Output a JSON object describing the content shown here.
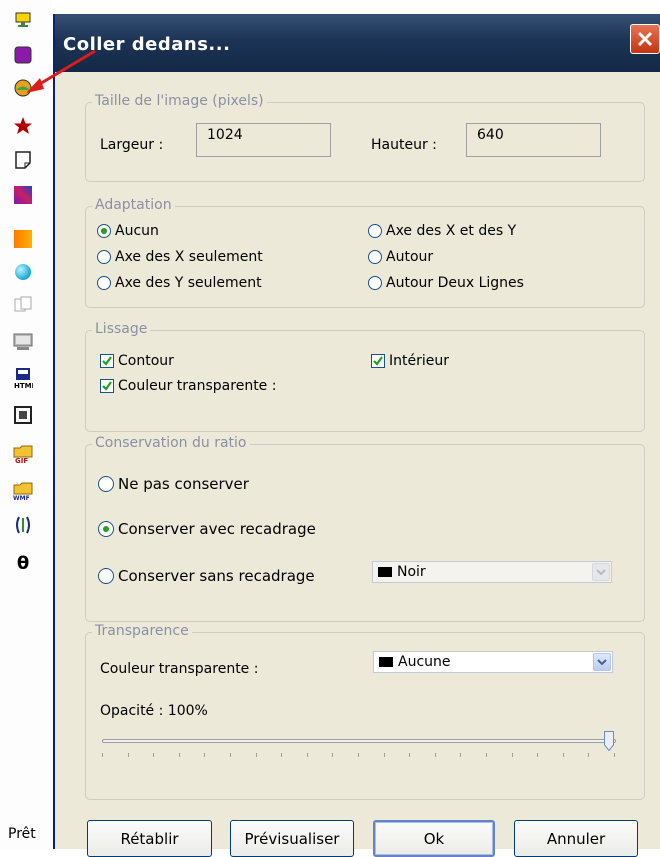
{
  "status": {
    "text": "Prêt"
  },
  "dialog": {
    "title": "Coller dedans...",
    "image_size": {
      "legend": "Taille de l'image (pixels)",
      "width_label": "Largeur :",
      "width_value": "1024",
      "height_label": "Hauteur :",
      "height_value": "640"
    },
    "adaptation": {
      "legend": "Adaptation",
      "options": [
        {
          "label": "Aucun",
          "selected": true
        },
        {
          "label": "Axe des X et des Y",
          "selected": false
        },
        {
          "label": "Axe des X seulement",
          "selected": false
        },
        {
          "label": "Autour",
          "selected": false
        },
        {
          "label": "Axe des Y seulement",
          "selected": false
        },
        {
          "label": "Autour Deux Lignes",
          "selected": false
        }
      ]
    },
    "smoothing": {
      "legend": "Lissage",
      "contour": {
        "label": "Contour",
        "checked": true
      },
      "interior": {
        "label": "Intérieur",
        "checked": true
      },
      "transparent_color": {
        "label": "Couleur transparente :",
        "checked": true
      }
    },
    "ratio": {
      "legend": "Conservation du ratio",
      "options": [
        {
          "label": "Ne pas conserver",
          "selected": false
        },
        {
          "label": "Conserver avec recadrage",
          "selected": true
        },
        {
          "label": "Conserver sans recadrage",
          "selected": false
        }
      ],
      "color_select": {
        "value": "Noir",
        "enabled": false
      }
    },
    "transparency": {
      "legend": "Transparence",
      "color_label": "Couleur transparente :",
      "color_select": {
        "value": "Aucune",
        "enabled": true
      },
      "opacity_label": "Opacité : 100%",
      "opacity_value": 100
    },
    "buttons": {
      "reset": "Rétablir",
      "preview": "Prévisualiser",
      "ok": "Ok",
      "cancel": "Annuler"
    }
  },
  "colors": {
    "title_bar": "#1c3456",
    "dialog_bg": "#ece9d8",
    "accent_arrow": "#e01b1b",
    "radio_dot": "#21a121",
    "check_mark": "#21a121"
  },
  "toolbar_icons": [
    "monitor-icon",
    "square-icon",
    "circle-image-icon",
    "star-icon",
    "note-icon",
    "gradient-icon",
    "orange-rect-icon",
    "sphere-icon",
    "copy-icon",
    "screenshot-icon",
    "html-icon",
    "frame-icon",
    "gif-folder-icon",
    "wmf-folder-icon",
    "bracket-icon",
    "theta-icon"
  ]
}
